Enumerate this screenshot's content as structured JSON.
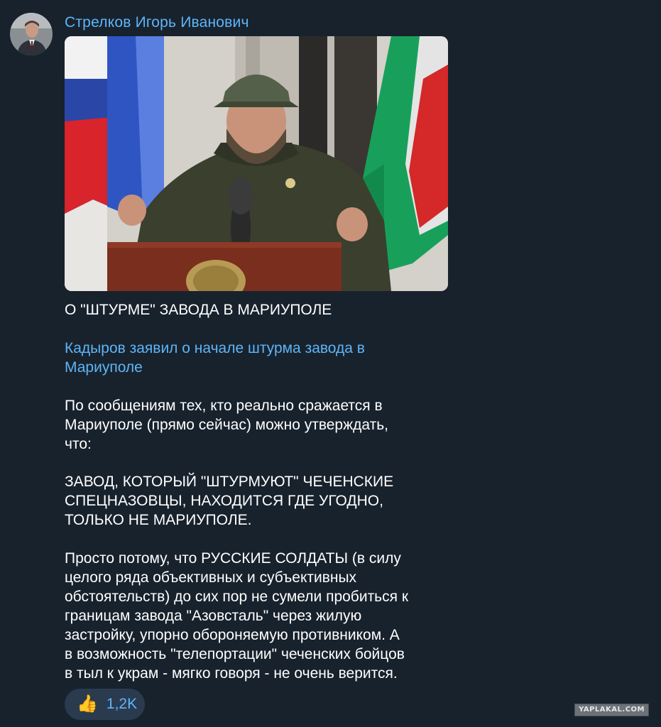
{
  "channel": {
    "name": "Стрелков Игорь Иванович",
    "avatar_icon": "user-avatar-icon"
  },
  "message": {
    "image_icon": "photo-image",
    "heading": "О \"ШТУРМЕ\" ЗАВОДА В МАРИУПОЛЕ",
    "link_text": "Кадыров заявил о начале штурма завода в\nМариуполе",
    "paragraph1": "По сообщениям тех, кто реально сражается в\nМариуполе (прямо сейчас) можно утверждать,\nчто:",
    "paragraph2": "ЗАВОД, КОТОРЫЙ \"ШТУРМУЮТ\" ЧЕЧЕНСКИЕ\nСПЕЦНАЗОВЦЫ, НАХОДИТСЯ ГДЕ УГОДНО,\nТОЛЬКО НЕ МАРИУПОЛЕ.",
    "paragraph3": "Просто потому, что РУССКИЕ СОЛДАТЫ (в силу\nцелого ряда объективных и субъективных\nобстоятельств) до сих пор не сумели пробиться к\nграницам завода \"Азовсталь\" через жилую\nзастройку, упорно обороняемую противником. А\nв возможность \"телепортации\" чеченских бойцов\nв тыл к украм - мягко говоря - не очень верится."
  },
  "reaction": {
    "emoji": "👍",
    "count": "1,2K",
    "icon": "thumbs-up-icon"
  },
  "watermark": {
    "text": "YAPLAKAL.COM"
  },
  "colors": {
    "background": "#18222d",
    "accent": "#5eb5f7",
    "reaction_bg": "#2b3b4f"
  }
}
